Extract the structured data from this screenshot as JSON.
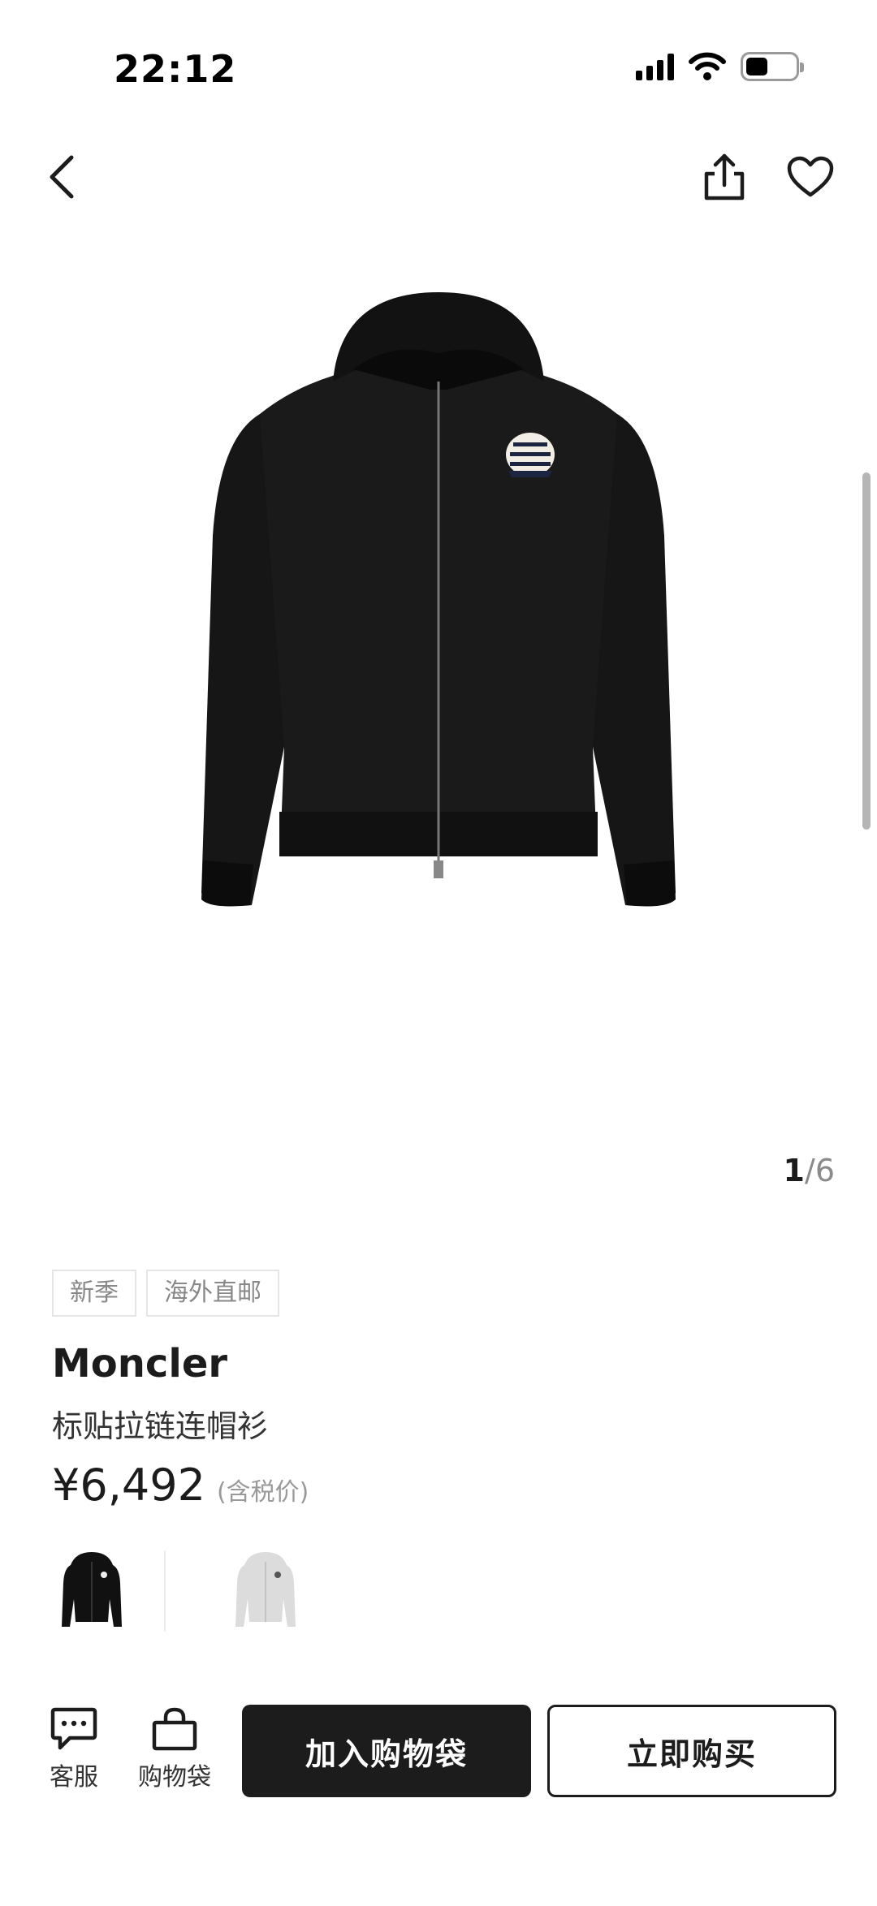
{
  "status_bar": {
    "time": "22:12",
    "icons": [
      "cellular-signal-icon",
      "wifi-icon",
      "battery-icon"
    ]
  },
  "nav": {
    "icons": [
      "back-arrow-icon",
      "share-icon",
      "heart-icon"
    ]
  },
  "gallery": {
    "current": "1",
    "separator": "/",
    "total": "6"
  },
  "product": {
    "tags": [
      "新季",
      "海外直邮"
    ],
    "brand": "Moncler",
    "name": "标贴拉链连帽衫",
    "price": "¥6,492",
    "tax_note": "(含税价)",
    "colors": [
      "#111111",
      "#dcdcdc"
    ]
  },
  "bottom_bar": {
    "service_label": "客服",
    "bag_label": "购物袋",
    "add_to_cart": "加入购物袋",
    "buy_now": "立即购买"
  }
}
